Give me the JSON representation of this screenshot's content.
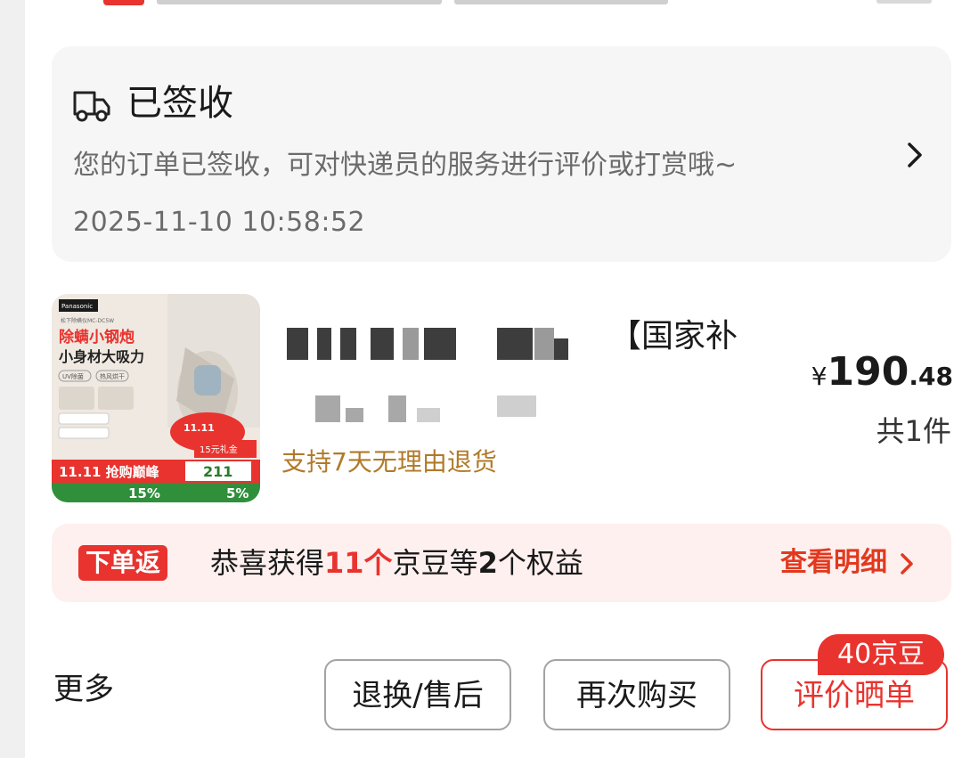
{
  "logistics": {
    "status": "已签收",
    "description": "您的订单已签收，可对快递员的服务进行评价或打赏哦~",
    "timestamp": "2025-11-10 10:58:52"
  },
  "product": {
    "title_suffix": "【国家补",
    "return_policy": "支持7天无理由退货",
    "price_currency": "¥",
    "price_integer": "190",
    "price_decimal": ".48",
    "quantity": "共1件",
    "image_texts": {
      "brand": "Panasonic",
      "model": "松下除螨仪MC-DC5W",
      "headline1": "除螨小钢炮",
      "headline2": "小身材大吸力",
      "chip1": "UV除菌",
      "chip2": "热风烘干",
      "promo": "11.11 抢购巅峰",
      "gift": "15元礼金",
      "subsidy_pct": "15%",
      "price_tag": "211",
      "extra_pct": "5%"
    }
  },
  "rebate": {
    "badge": "下单返",
    "msg_prefix": "恭喜获得",
    "msg_count": "11个",
    "msg_middle": "京豆等",
    "msg_num": "2",
    "msg_suffix": "个权益",
    "detail_link": "查看明细"
  },
  "actions": {
    "more": "更多",
    "after_sales": "退换/售后",
    "rebuy": "再次购买",
    "review": "评价晒单",
    "review_tag": "40京豆"
  },
  "colors": {
    "accent": "#e9332e",
    "return_text": "#b07a2a",
    "secondary_text": "#6b6b6b"
  }
}
